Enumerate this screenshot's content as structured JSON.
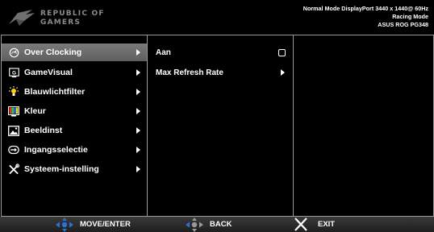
{
  "header": {
    "brand_line1": "REPUBLIC OF",
    "brand_line2": "GAMERS",
    "status_line1": "Normal Mode DisplayPort 3440 x 1440@ 60Hz",
    "status_line2": "Racing Mode",
    "status_line3": "ASUS ROG PG348"
  },
  "menu": {
    "items": [
      {
        "label": "Over Clocking",
        "icon": "overclock-icon",
        "selected": true
      },
      {
        "label": "GameVisual",
        "icon": "gamevisual-icon",
        "selected": false
      },
      {
        "label": "Blauwlichtfilter",
        "icon": "bluelight-icon",
        "selected": false
      },
      {
        "label": "Kleur",
        "icon": "color-icon",
        "selected": false
      },
      {
        "label": "Beeldinst",
        "icon": "image-icon",
        "selected": false
      },
      {
        "label": "Ingangsselectie",
        "icon": "input-icon",
        "selected": false
      },
      {
        "label": "Systeem-instelling",
        "icon": "tools-icon",
        "selected": false
      }
    ]
  },
  "submenu": {
    "items": [
      {
        "label": "Aan",
        "control": "checkbox"
      },
      {
        "label": "Max Refresh Rate",
        "control": "arrow"
      }
    ]
  },
  "footer": {
    "move_enter": "MOVE/ENTER",
    "back": "BACK",
    "exit": "EXIT",
    "accent_color": "#2f6fd8"
  }
}
